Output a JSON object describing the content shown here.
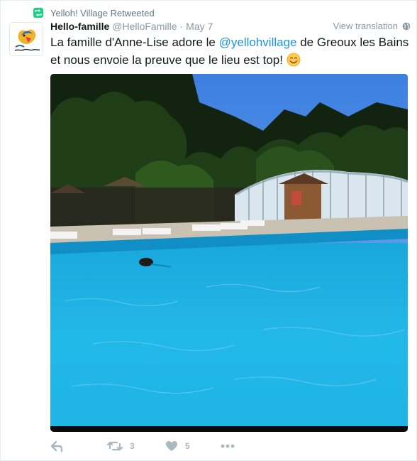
{
  "retweet_context": {
    "icon": "retweet-badge-icon",
    "text": "Yelloh! Village Retweeted"
  },
  "tweet": {
    "fullname": "Hello-famille",
    "username": "@HelloFamille",
    "separator": "·",
    "timestamp": "May 7",
    "translate_label": "View translation",
    "text_before": "La famille d'Anne-Lise adore le ",
    "mention": "@yellohvillage",
    "text_after": " de Greoux les Bains et nous envoie la preuve que le lieu est top!",
    "emoji": "smiling-face-emoji"
  },
  "media": {
    "description_icon": "pool-photo"
  },
  "actions": {
    "reply": {
      "icon": "reply-icon"
    },
    "retweet": {
      "icon": "retweet-icon",
      "count": "3"
    },
    "like": {
      "icon": "heart-icon",
      "count": "5"
    },
    "more": {
      "icon": "more-icon"
    }
  },
  "colors": {
    "link": "#1b95e0",
    "retweet_green": "#19cf86",
    "muted": "#8899a6",
    "action": "#aab8c2"
  }
}
